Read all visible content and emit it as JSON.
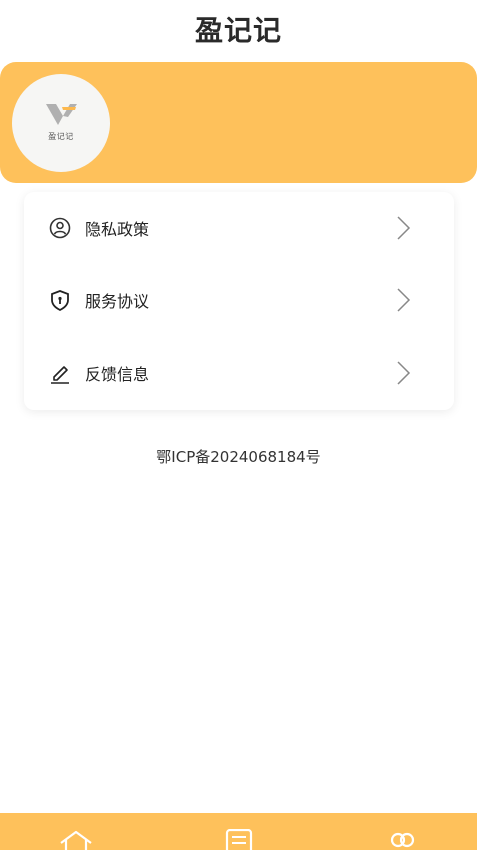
{
  "header": {
    "title": "盈记记"
  },
  "brand": {
    "logo_text": "盈记记",
    "accent_color": "#fec15b"
  },
  "menu": {
    "items": [
      {
        "label": "隐私政策",
        "icon": "user-circle-icon"
      },
      {
        "label": "服务协议",
        "icon": "shield-icon"
      },
      {
        "label": "反馈信息",
        "icon": "edit-icon"
      }
    ]
  },
  "footer": {
    "icp": "鄂ICP备2024068184号"
  },
  "tabbar": {
    "tabs": [
      {
        "icon": "home-icon"
      },
      {
        "icon": "list-icon"
      },
      {
        "icon": "user-icon"
      }
    ]
  }
}
